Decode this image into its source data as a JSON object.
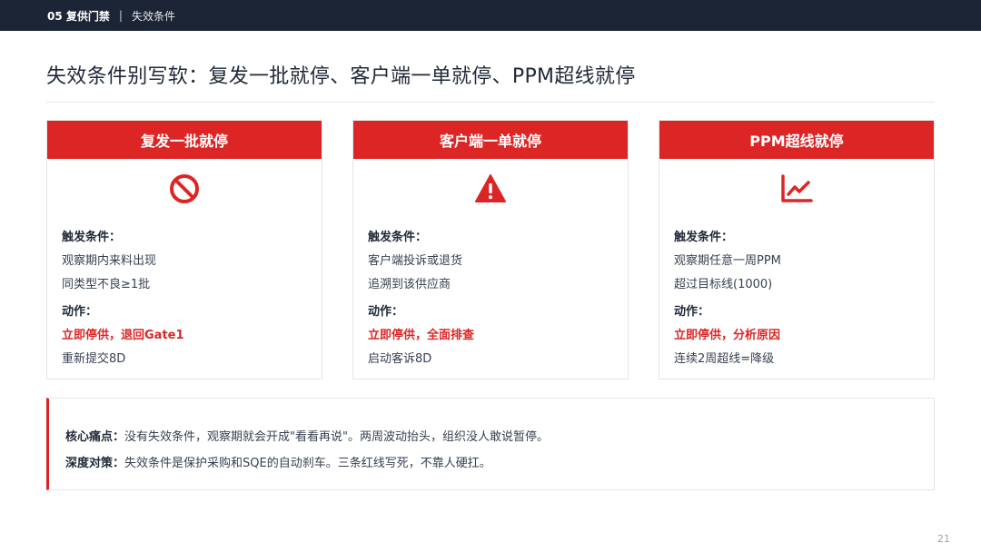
{
  "header": {
    "section": "05 复供门禁",
    "separator": "|",
    "crumb": "失效条件"
  },
  "title": "失效条件别写软：复发一批就停、客户端一单就停、PPM超线就停",
  "cards": [
    {
      "title": "复发一批就停",
      "icon": "no-entry-icon",
      "trigger_label": "触发条件：",
      "trigger_lines": [
        "观察期内来料出现",
        "同类型不良≥1批"
      ],
      "action_label": "动作：",
      "action_primary": "立即停供，退回Gate1",
      "action_secondary": "重新提交8D"
    },
    {
      "title": "客户端一单就停",
      "icon": "warning-triangle-icon",
      "trigger_label": "触发条件：",
      "trigger_lines": [
        "客户端投诉或退货",
        "追溯到该供应商"
      ],
      "action_label": "动作：",
      "action_primary": "立即停供，全面排查",
      "action_secondary": "启动客诉8D"
    },
    {
      "title": "PPM超线就停",
      "icon": "trend-chart-icon",
      "trigger_label": "触发条件：",
      "trigger_lines": [
        "观察期任意一周PPM",
        "超过目标线(1000)"
      ],
      "action_label": "动作：",
      "action_primary": "立即停供，分析原因",
      "action_secondary": "连续2周超线=降级"
    }
  ],
  "note": {
    "pain_label": "核心痛点：",
    "pain_text": "没有失效条件，观察期就会开成\"看看再说\"。两周波动抬头，组织没人敢说暂停。",
    "strategy_label": "深度对策：",
    "strategy_text": "失效条件是保护采购和SQE的自动刹车。三条红线写死，不靠人硬扛。"
  },
  "page_number": "21",
  "colors": {
    "accent": "#dc2626",
    "topbar": "#1c2536"
  }
}
